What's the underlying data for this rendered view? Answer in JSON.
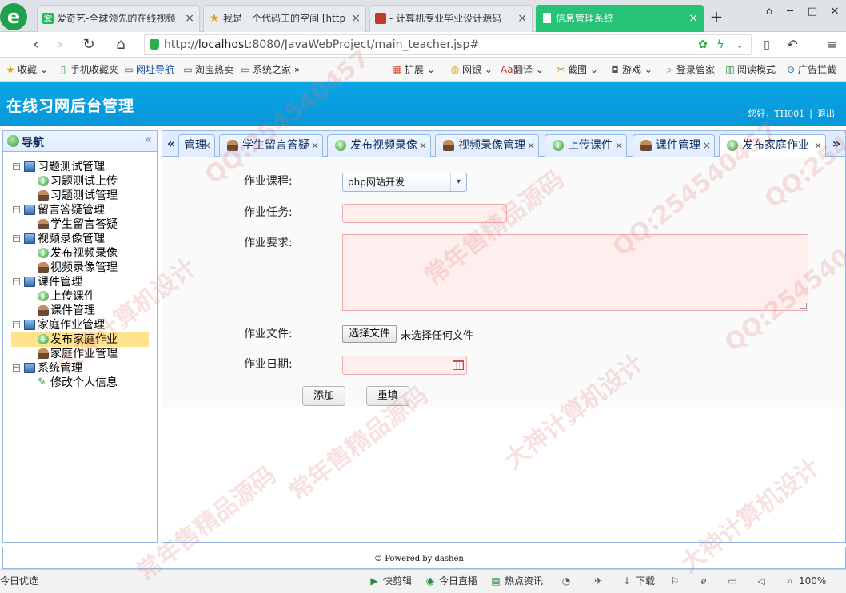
{
  "browser": {
    "tabs": [
      {
        "label": "爱奇艺-全球领先的在线视频",
        "active": false,
        "icon": "iqiyi-icon"
      },
      {
        "label": "我是一个代码工的空间 [http",
        "active": false,
        "icon": "star-icon"
      },
      {
        "label": "- 计算机专业毕业设计源码",
        "active": false,
        "icon": "site-icon"
      },
      {
        "label": "信息管理系统",
        "active": true,
        "icon": "page-icon"
      }
    ],
    "url": {
      "scheme": "http://",
      "host": "localhost",
      "rest": ":8080/JavaWebProject/main_teacher.jsp#"
    },
    "bookmarks": [
      "收藏",
      "手机收藏夹",
      "网址导航",
      "淘宝热卖",
      "系统之家"
    ],
    "bookmarks_right": [
      "扩展",
      "网银",
      "翻译",
      "截图",
      "游戏",
      "登录管家",
      "阅读模式",
      "广告拦截"
    ],
    "status": [
      "今日优选",
      "快剪辑",
      "今日直播",
      "热点资讯",
      "下载",
      "100%"
    ]
  },
  "header": {
    "title": "在线习网后台管理",
    "greeting": "您好，TH001",
    "logout": "退出"
  },
  "sidebar": {
    "title": "导航",
    "groups": [
      {
        "label": "习题测试管理",
        "items": [
          {
            "label": "习题测试上传",
            "icon": "add"
          },
          {
            "label": "习题测试管理",
            "icon": "user"
          }
        ]
      },
      {
        "label": "留言答疑管理",
        "items": [
          {
            "label": "学生留言答疑",
            "icon": "user"
          }
        ]
      },
      {
        "label": "视频录像管理",
        "items": [
          {
            "label": "发布视频录像",
            "icon": "add"
          },
          {
            "label": "视频录像管理",
            "icon": "user"
          }
        ]
      },
      {
        "label": "课件管理",
        "items": [
          {
            "label": "上传课件",
            "icon": "add"
          },
          {
            "label": "课件管理",
            "icon": "user"
          }
        ]
      },
      {
        "label": "家庭作业管理",
        "items": [
          {
            "label": "发布家庭作业",
            "icon": "add",
            "selected": true
          },
          {
            "label": "家庭作业管理",
            "icon": "user"
          }
        ]
      },
      {
        "label": "系统管理",
        "items": [
          {
            "label": "修改个人信息",
            "icon": "pencil"
          }
        ]
      }
    ]
  },
  "tabs": [
    {
      "label": "管理",
      "icon": "none"
    },
    {
      "label": "学生留言答疑",
      "icon": "user"
    },
    {
      "label": "发布视频录像",
      "icon": "add"
    },
    {
      "label": "视频录像管理",
      "icon": "user"
    },
    {
      "label": "上传课件",
      "icon": "add"
    },
    {
      "label": "课件管理",
      "icon": "user"
    },
    {
      "label": "发布家庭作业",
      "icon": "add",
      "active": true
    }
  ],
  "form": {
    "course_label": "作业课程:",
    "course_value": "php网站开发",
    "task_label": "作业任务:",
    "task_value": "",
    "req_label": "作业要求:",
    "req_value": "",
    "file_label": "作业文件:",
    "file_button": "选择文件",
    "file_status": "未选择任何文件",
    "date_label": "作业日期:",
    "date_value": "",
    "submit": "添加",
    "reset": "重填"
  },
  "footer": {
    "powered": "Powered by dashen"
  }
}
